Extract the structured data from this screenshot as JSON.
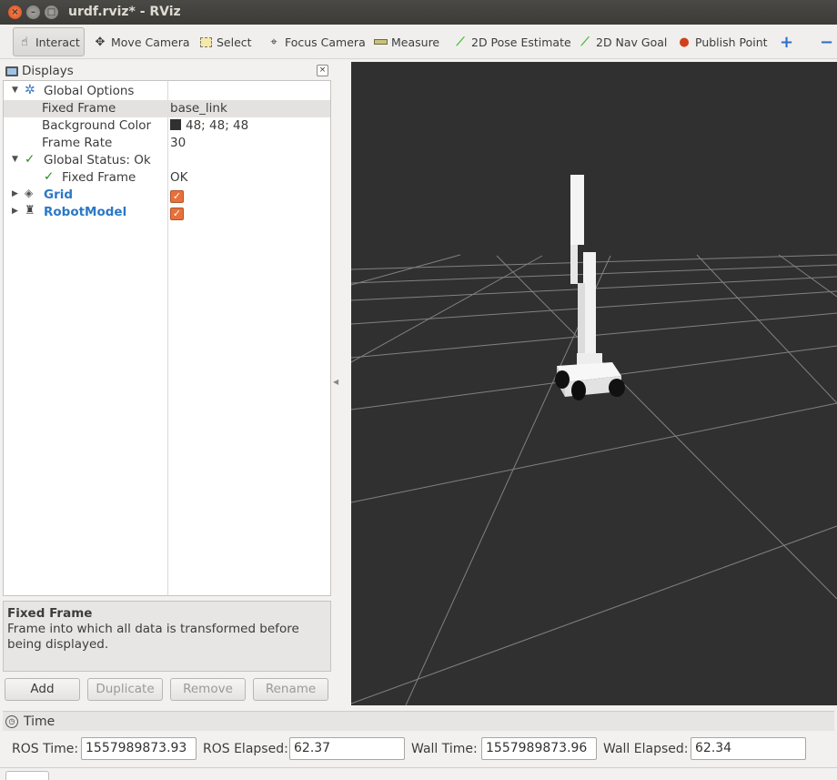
{
  "window": {
    "title": "urdf.rviz* - RViz",
    "close_glyph": "×",
    "min_glyph": "–",
    "max_glyph": "□"
  },
  "toolbar": {
    "interact": "Interact",
    "move_camera": "Move Camera",
    "select": "Select",
    "focus_camera": "Focus Camera",
    "measure": "Measure",
    "pose_estimate": "2D Pose Estimate",
    "nav_goal": "2D Nav Goal",
    "publish_point": "Publish Point",
    "add_tool": "+",
    "remove_tool": "−"
  },
  "displays": {
    "title": "Displays",
    "close": "×",
    "global_options": "Global Options",
    "fixed_frame_label": "Fixed Frame",
    "fixed_frame_value": "base_link",
    "background_color_label": "Background Color",
    "background_color_value": "48; 48; 48",
    "frame_rate_label": "Frame Rate",
    "frame_rate_value": "30",
    "global_status": "Global Status: Ok",
    "status_fixed_frame_label": "Fixed Frame",
    "status_fixed_frame_value": "OK",
    "grid": "Grid",
    "robot_model": "RobotModel",
    "grid_enabled": true,
    "robot_model_enabled": true
  },
  "description": {
    "title": "Fixed Frame",
    "text": "Frame into which all data is transformed before being displayed."
  },
  "buttons": {
    "add": "Add",
    "duplicate": "Duplicate",
    "remove": "Remove",
    "rename": "Rename"
  },
  "time": {
    "title": "Time",
    "ros_time_label": "ROS Time:",
    "ros_time": "1557989873.93",
    "ros_elapsed_label": "ROS Elapsed:",
    "ros_elapsed": "62.37",
    "wall_time_label": "Wall Time:",
    "wall_time": "1557989873.96",
    "wall_elapsed_label": "Wall Elapsed:",
    "wall_elapsed": "62.34"
  },
  "colors": {
    "viewport_bg": "#303030",
    "grid_line": "#a0a0a0",
    "accent_check": "#e8703a",
    "link_blue": "#2a78c5"
  },
  "icons": [
    "hand-pointer-icon",
    "move-camera-icon",
    "select-icon",
    "focus-camera-icon",
    "measure-icon",
    "pose-estimate-icon",
    "nav-goal-icon",
    "publish-point-icon",
    "monitor-icon",
    "gear-icon",
    "check-icon",
    "grid-icon",
    "robot-icon",
    "clock-icon"
  ]
}
